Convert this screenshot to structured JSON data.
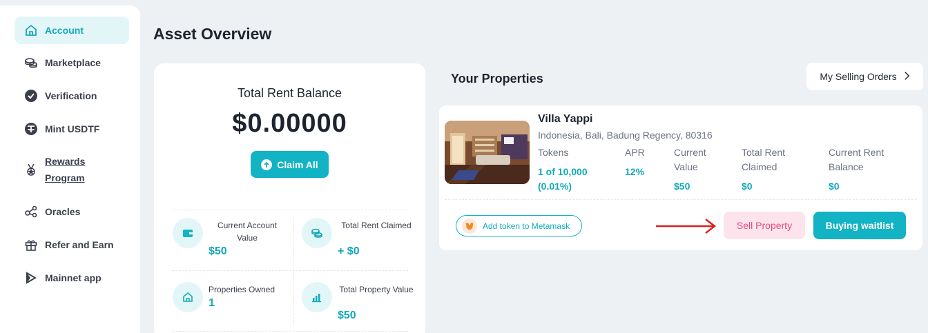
{
  "sidebar": {
    "items": [
      {
        "label": "Account",
        "icon": "home-icon",
        "active": true
      },
      {
        "label": "Marketplace",
        "icon": "coins-icon"
      },
      {
        "label": "Verification",
        "icon": "check-badge-icon"
      },
      {
        "label": "Mint USDTF",
        "icon": "tether-icon"
      },
      {
        "label": "Rewards Program",
        "icon": "medal-icon"
      },
      {
        "label": "Oracles",
        "icon": "share-nodes-icon"
      },
      {
        "label": "Refer and Earn",
        "icon": "gift-icon"
      },
      {
        "label": "Mainnet app",
        "icon": "mainnet-icon"
      }
    ]
  },
  "page": {
    "title": "Asset Overview"
  },
  "balance": {
    "title": "Total Rent Balance",
    "amount": "$0.00000",
    "claim_label": "Claim All",
    "stats": [
      {
        "label": "Current Account Value",
        "value": "$50",
        "icon": "wallet-icon"
      },
      {
        "label": "Total Rent Claimed",
        "value": "+ $0",
        "icon": "coins-icon"
      },
      {
        "label": "Properties Owned",
        "value": "1",
        "icon": "home-icon"
      },
      {
        "label": "Total Property Value",
        "value": "$50",
        "icon": "bar-chart-icon"
      }
    ]
  },
  "properties": {
    "title": "Your Properties",
    "selling_orders_label": "My Selling Orders",
    "items": [
      {
        "name": "Villa Yappi",
        "location": "Indonesia, Bali, Badung Regency, 80316",
        "columns": [
          {
            "header": "Tokens",
            "value": "1 of 10,000 (0.01%)"
          },
          {
            "header": "APR",
            "value": "12%"
          },
          {
            "header": "Current Value",
            "value": "$50"
          },
          {
            "header": "Total Rent Claimed",
            "value": "$0"
          },
          {
            "header": "Current Rent Balance",
            "value": "$0"
          }
        ],
        "metamask_label": "Add token to Metamask",
        "sell_label": "Sell Property",
        "waitlist_label": "Buying waitlist"
      }
    ]
  },
  "colors": {
    "accent": "#12b3c4",
    "sell": "#e04b7f",
    "arrow": "#e01e1e"
  }
}
